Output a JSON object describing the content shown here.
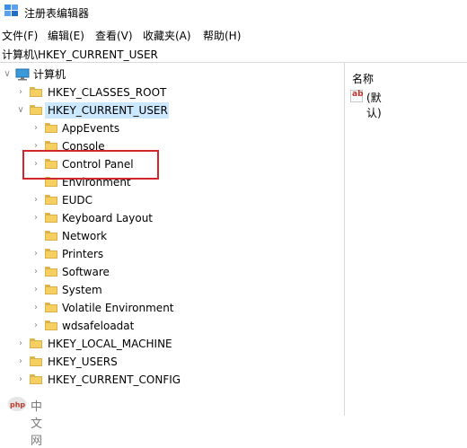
{
  "window": {
    "title": "注册表编辑器"
  },
  "menu": [
    {
      "label": "文件(F)"
    },
    {
      "label": "编辑(E)"
    },
    {
      "label": "查看(V)"
    },
    {
      "label": "收藏夹(A)"
    },
    {
      "label": "帮助(H)"
    }
  ],
  "address": "计算机\\HKEY_CURRENT_USER",
  "tree": {
    "root": "计算机",
    "hkcr": "HKEY_CLASSES_ROOT",
    "hkcu": "HKEY_CURRENT_USER",
    "hkcu_children": [
      "AppEvents",
      "Console",
      "Control Panel",
      "Environment",
      "EUDC",
      "Keyboard Layout",
      "Network",
      "Printers",
      "Software",
      "System",
      "Volatile Environment",
      "wdsafeloadat"
    ],
    "hklm": "HKEY_LOCAL_MACHINE",
    "hku": "HKEY_USERS",
    "hkcc": "HKEY_CURRENT_CONFIG"
  },
  "values_pane": {
    "column_name": "名称",
    "rows": [
      {
        "icon": "string-value-icon",
        "name": "(默认)"
      }
    ]
  },
  "watermark": {
    "text": "中文网",
    "logo": "php"
  },
  "colors": {
    "selection": "#cce8ff",
    "highlight": "#d0262c",
    "folder": "#f5cf5f"
  }
}
